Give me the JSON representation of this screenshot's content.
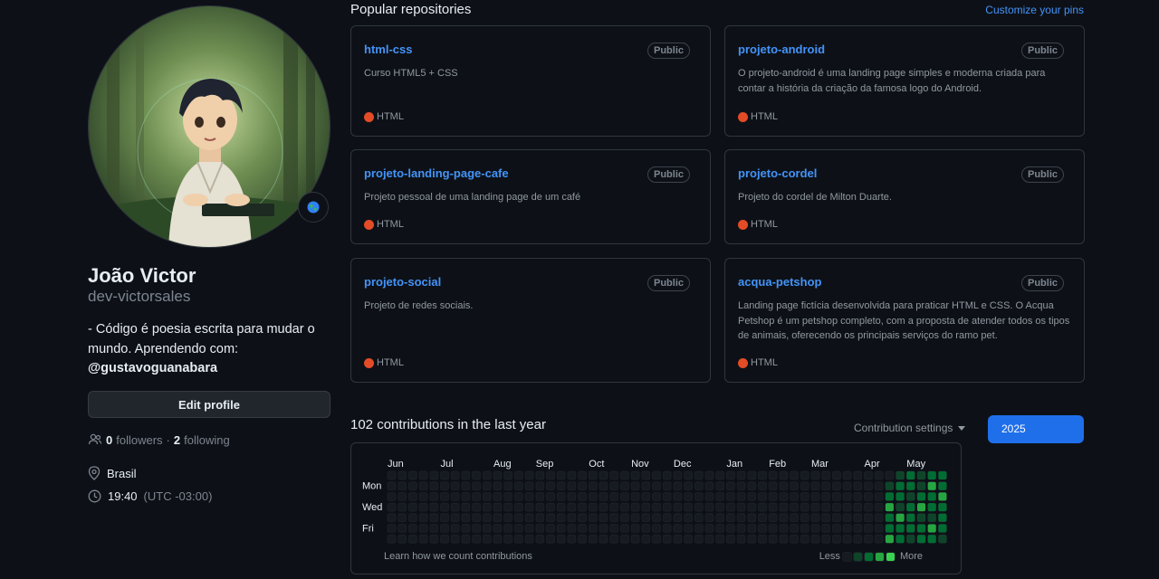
{
  "profile": {
    "name": "João Victor",
    "login": "dev-victorsales",
    "bio_text": "- Código é poesia escrita para mudar o mundo. Aprendendo com:",
    "bio_handle": "@gustavoguanabara",
    "edit_label": "Edit profile",
    "followers_count": "0",
    "followers_label": "followers",
    "separator": "·",
    "following_count": "2",
    "following_label": "following",
    "location": "Brasil",
    "local_time": "19:40",
    "timezone": "(UTC -03:00)"
  },
  "popular": {
    "title": "Popular repositories",
    "customize_label": "Customize your pins",
    "repos": [
      {
        "name": "html-css",
        "visibility": "Public",
        "description": "Curso HTML5 + CSS",
        "language": "HTML"
      },
      {
        "name": "projeto-android",
        "visibility": "Public",
        "description": "O projeto-android é uma landing page simples e moderna criada para contar a história da criação da famosa logo do Android.",
        "language": "HTML"
      },
      {
        "name": "projeto-landing-page-cafe",
        "visibility": "Public",
        "description": "Projeto pessoal de uma landing page de um café",
        "language": "HTML"
      },
      {
        "name": "projeto-cordel",
        "visibility": "Public",
        "description": "Projeto do cordel de Milton Duarte.",
        "language": "HTML"
      },
      {
        "name": "projeto-social",
        "visibility": "Public",
        "description": "Projeto de redes sociais.",
        "language": "HTML"
      },
      {
        "name": "acqua-petshop",
        "visibility": "Public",
        "description": "Landing page fictícia desenvolvida para praticar HTML e CSS. O Acqua Petshop é um petshop completo, com a proposta de atender todos os tipos de animais, oferecendo os principais serviços do ramo pet.",
        "language": "HTML"
      }
    ],
    "language_color": "#e34c26"
  },
  "contributions": {
    "title": "102 contributions in the last year",
    "settings_label": "Contribution settings",
    "year": "2025",
    "months": [
      "Jun",
      "Jul",
      "Aug",
      "Sep",
      "Oct",
      "Nov",
      "Dec",
      "Jan",
      "Feb",
      "Mar",
      "Apr",
      "May"
    ],
    "days": [
      "Mon",
      "Wed",
      "Fri"
    ],
    "learn_label": "Learn how we count contributions",
    "less_label": "Less",
    "more_label": "More",
    "levels": [
      "#161b22",
      "#0e4429",
      "#006d32",
      "#26a641",
      "#39d353"
    ],
    "active_weeks": [
      [
        0,
        1,
        2,
        3,
        2,
        2,
        3
      ],
      [
        1,
        2,
        2,
        1,
        3,
        2,
        2
      ],
      [
        2,
        2,
        1,
        2,
        2,
        2,
        1
      ],
      [
        1,
        1,
        2,
        3,
        1,
        2,
        2
      ],
      [
        2,
        3,
        2,
        2,
        1,
        3,
        2
      ],
      [
        2,
        2,
        3,
        2,
        2,
        2,
        1
      ]
    ]
  },
  "colors": {
    "accent": "#4493f8",
    "primary_button": "#1f6feb",
    "background": "#0d1117",
    "border": "#30363d"
  }
}
